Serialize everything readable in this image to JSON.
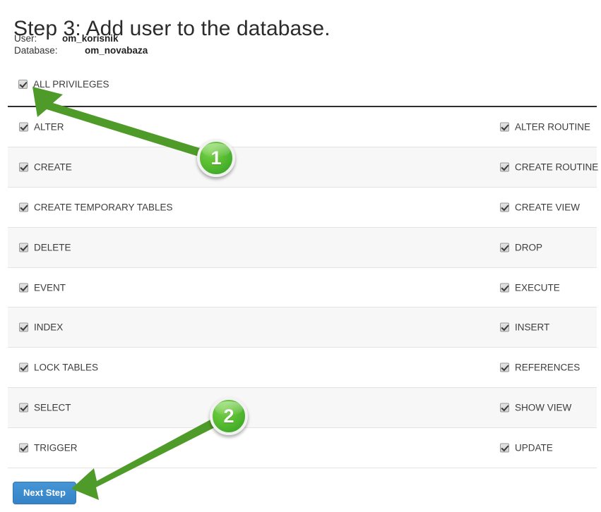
{
  "page": {
    "title": "Step 3: Add user to the database."
  },
  "meta": {
    "user_label": "User:",
    "user_value": "om_korisnik",
    "database_label": "Database:",
    "database_value": "om_novabaza"
  },
  "all_privileges": {
    "label": "ALL PRIVILEGES",
    "checked": true
  },
  "privileges": [
    {
      "left": "ALTER",
      "right": "ALTER ROUTINE"
    },
    {
      "left": "CREATE",
      "right": "CREATE ROUTINE"
    },
    {
      "left": "CREATE TEMPORARY TABLES",
      "right": "CREATE VIEW"
    },
    {
      "left": "DELETE",
      "right": "DROP"
    },
    {
      "left": "EVENT",
      "right": "EXECUTE"
    },
    {
      "left": "INDEX",
      "right": "INSERT"
    },
    {
      "left": "LOCK TABLES",
      "right": "REFERENCES"
    },
    {
      "left": "SELECT",
      "right": "SHOW VIEW"
    },
    {
      "left": "TRIGGER",
      "right": "UPDATE"
    }
  ],
  "actions": {
    "next_step_label": "Next Step"
  },
  "annotations": {
    "badge_1": "1",
    "badge_2": "2",
    "arrow_color": "#4f9b29",
    "badge_color": "#5cbf33",
    "arrow_1_target": "ALL PRIVILEGES checkbox",
    "arrow_2_target": "Next Step button"
  },
  "colors": {
    "primary_button": "#3583c6",
    "row_stripe": "#f7f7f7",
    "table_top_border": "#2e2e2e",
    "text": "#3d3d3d"
  }
}
